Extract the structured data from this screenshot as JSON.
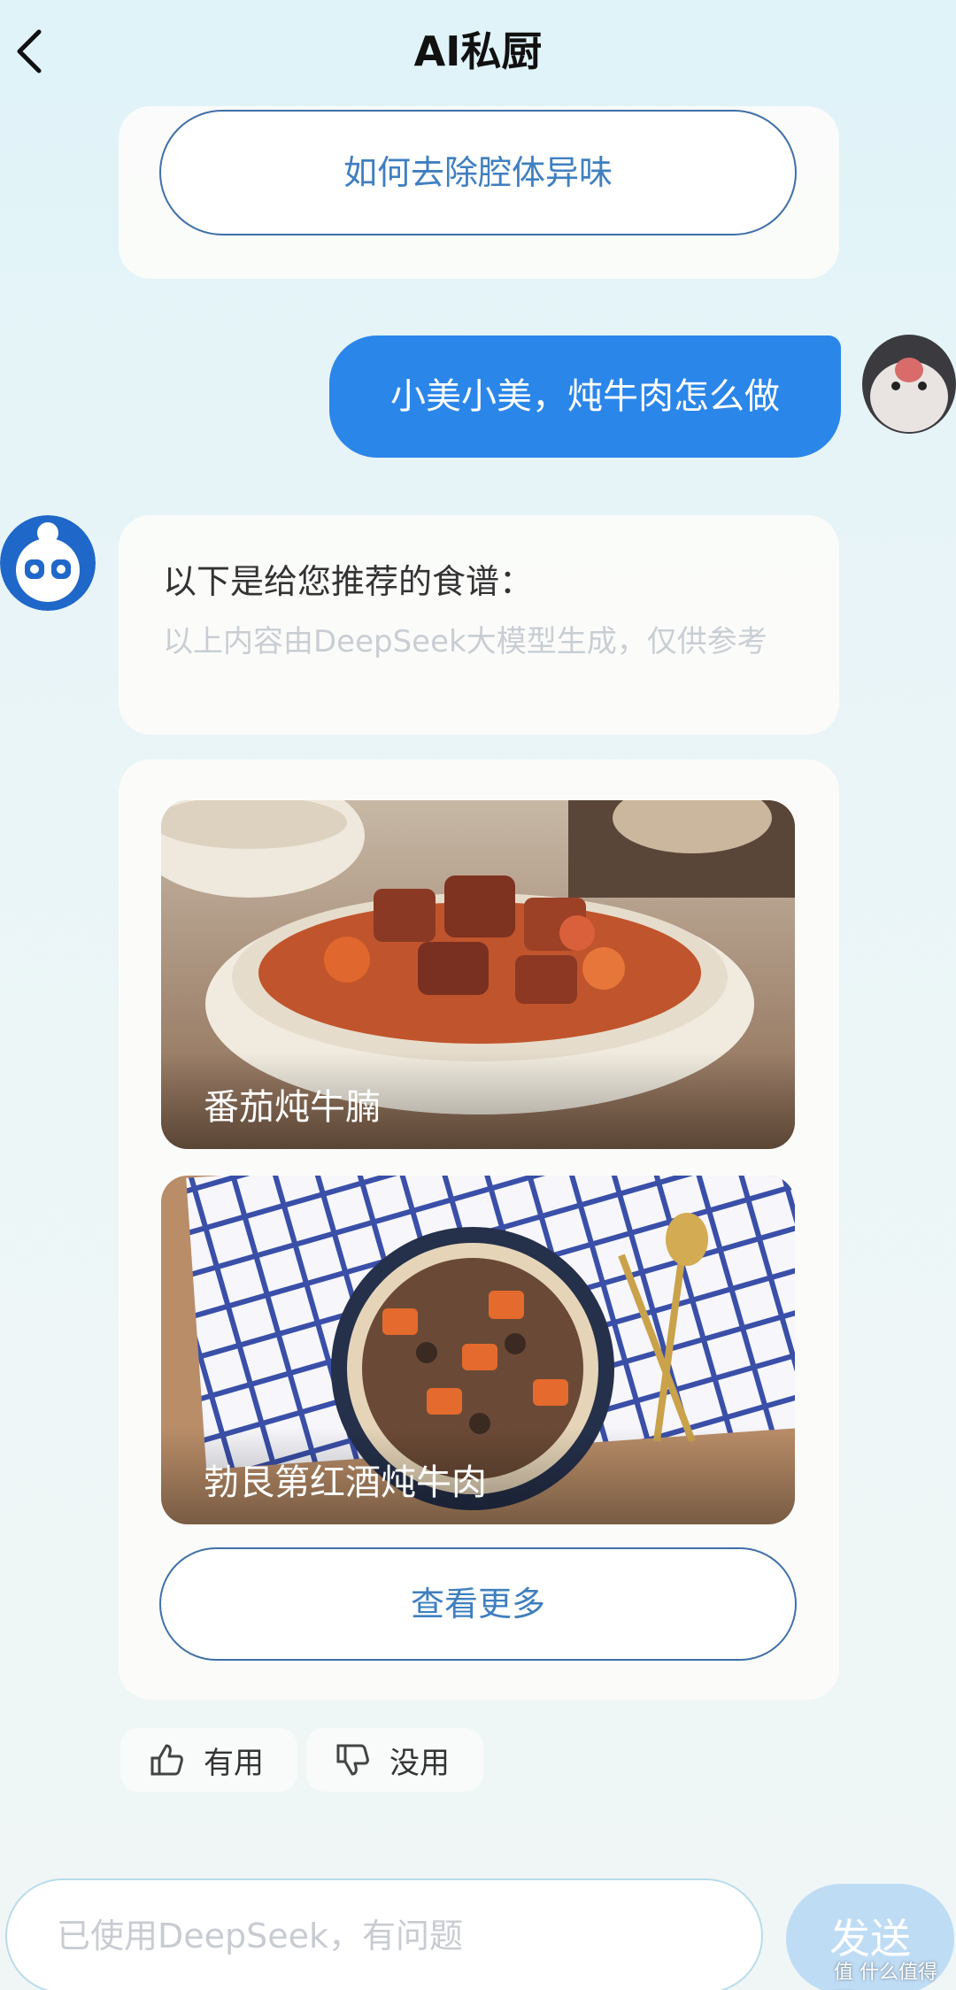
{
  "header": {
    "title": "AI私厨"
  },
  "suggestion": {
    "label": "如何去除腔体异味"
  },
  "user_message": {
    "text": "小美小美，炖牛肉怎么做"
  },
  "bot_message": {
    "text": "以下是给您推荐的食谱：",
    "disclaimer": "以上内容由DeepSeek大模型生成，仅供参考"
  },
  "recipes": [
    {
      "name": "番茄炖牛腩"
    },
    {
      "name": "勃艮第红酒炖牛肉"
    }
  ],
  "more_button": {
    "label": "查看更多"
  },
  "feedback": {
    "useful": "有用",
    "useless": "没用"
  },
  "input": {
    "placeholder": "已使用DeepSeek，有问题"
  },
  "send_button": {
    "label": "发送"
  },
  "watermark": "值 什么值得买",
  "colors": {
    "user_bubble": "#2b86ea",
    "button_border": "#3f6fa8",
    "send_disabled": "#bfdcf5"
  }
}
